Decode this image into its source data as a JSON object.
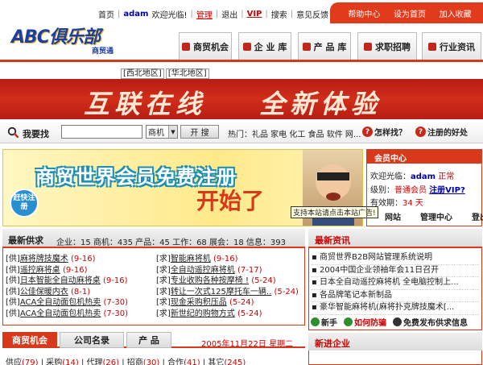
{
  "topbar": {
    "links": [
      "首页",
      "adam",
      "欢迎光临!",
      "管理",
      "退出",
      "VIP",
      "搜索",
      "意见反馈"
    ],
    "right": [
      "帮助中心",
      "设为首页",
      "加入收藏"
    ]
  },
  "logo": {
    "main": "ABC俱乐部",
    "sub": "商贸通"
  },
  "nav": [
    "商贸机会",
    "企 业 库",
    "产 品 库",
    "求职招聘",
    "行业资讯"
  ],
  "regions": [
    "[西北地区]",
    "[华北地区]"
  ],
  "banner": {
    "left": "互联在线",
    "right": "全新体验"
  },
  "search": {
    "label": "我要找",
    "value": "",
    "select": "商机",
    "button": "开 搜",
    "hot": "热门：礼品 家电 化工 食品 软件 网...",
    "how": "怎样找？",
    "register": "注册的好处"
  },
  "ad": {
    "title": "商贸世界会员免费注册",
    "big": "开始了",
    "badge": "赶快注册",
    "tooltip": "支持本站请点击本站广告!"
  },
  "member": {
    "head": "会员中心",
    "welcome_prefix": "欢迎光临：",
    "user": "adam",
    "status": "正常",
    "level_prefix": "级别：",
    "level": "普通会员",
    "vip_link": "注册VIP?",
    "expire_prefix": "有效期：",
    "expire": "34 天",
    "links": [
      "网站",
      "管理中心",
      "登出"
    ]
  },
  "supply": {
    "title": "最新供求",
    "stats": "企业：15  商机：435  产品：45  工作：68  展会：18  信息：393",
    "left": [
      {
        "tag": "[供]",
        "name": "麻将牌技魔术",
        "count": "(9-16)"
      },
      {
        "tag": "[供]",
        "name": "遥控麻将桌",
        "count": "(9-16)"
      },
      {
        "tag": "[供]",
        "name": "日本智能全自动麻将桌",
        "count": "(9-16)"
      },
      {
        "tag": "[供]",
        "name": "公佳保暖内衣",
        "count": "(8-1)"
      },
      {
        "tag": "[供]",
        "name": "ACA全自动面包机热卖",
        "count": "(7-30)"
      },
      {
        "tag": "[供]",
        "name": "ACA全自动面包机热卖",
        "count": "(7-30)"
      }
    ],
    "right": [
      {
        "tag": "[求]",
        "name": "智能麻将机",
        "count": "(9-16)"
      },
      {
        "tag": "[求]",
        "name": "全自动遥控麻将机",
        "count": "(7-17)"
      },
      {
        "tag": "[求]",
        "name": "专业收购各种按摩椅 !",
        "count": "(5-24)"
      },
      {
        "tag": "[求]",
        "name": "转让一次式125摩托车一辆..",
        "count": "(5-24)"
      },
      {
        "tag": "[求]",
        "name": "现金采购积压品",
        "count": "(5-24)"
      },
      {
        "tag": "[求]",
        "name": "新世纪的购物方式",
        "count": "(5-24)"
      }
    ]
  },
  "bottom": {
    "tabs": [
      "商贸机会",
      "公司名录",
      "产 品"
    ],
    "date": "2005年11月22日 星期二",
    "cats": [
      {
        "name": "供应",
        "count": "(79)"
      },
      {
        "name": "采购",
        "count": "(14)"
      },
      {
        "name": "代理",
        "count": "(26)"
      },
      {
        "name": "招商",
        "count": "(30)"
      },
      {
        "name": "合作",
        "count": "(41)"
      },
      {
        "name": "其它",
        "count": "(245)"
      }
    ]
  },
  "news": {
    "title": "最新资讯",
    "items": [
      "商贸世界B2B网站管理系统说明",
      "2004中国企业领袖年会11日召开",
      "日本全自动遥控麻将机 全电脑控制上...",
      "各品牌笔记本新制品",
      "豪华智能麻将机(麻将扑克牌技魔术[..."
    ],
    "icons": [
      "新手",
      "如何防骗",
      "免费发布供求信息"
    ]
  },
  "new_enterprise": {
    "title": "新进企业"
  },
  "colors": {
    "accent": "#d8391b",
    "link_red": "#cc0000",
    "link_blue": "#0000aa"
  }
}
